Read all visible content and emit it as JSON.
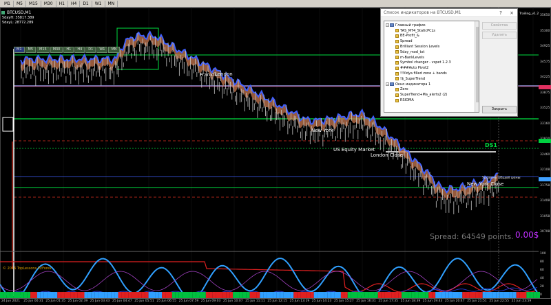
{
  "toolbar": {
    "timeframes": [
      "M1",
      "M5",
      "M15",
      "M30",
      "H1",
      "H4",
      "D1",
      "W1",
      "MN"
    ]
  },
  "chart": {
    "symbol_title": "BTCUSD,M1",
    "info_lines": [
      "5dayH: 35817.389",
      "5dayL: 28772.289"
    ],
    "mini_timeframes": [
      "M1",
      "M5",
      "M15",
      "M30",
      "H1",
      "H4",
      "D1",
      "W1",
      "MN"
    ],
    "session_labels": [
      "Frankfurt",
      "London",
      "New York",
      "US Equity Market",
      "London Close",
      "New York Close"
    ],
    "spread_text": "Spread: 64549 points.",
    "profit_text": "0.00$",
    "ds1_label": "DS1",
    "level_label": "Уровень общей цены",
    "copyright": "© 2016 TopLessons.In/Forex",
    "top_right_label": "Trailing_v1.2",
    "prices": [
      "35650",
      "35300",
      "34925",
      "34575",
      "34225",
      "33875",
      "33525",
      "33160",
      "32810",
      "32460",
      "32108",
      "31758",
      "31408",
      "31058",
      "30708"
    ],
    "time_labels": [
      "24 Jun 2021",
      "25 Jun 00:31",
      "25 Jun 01:35",
      "25 Jun 02:39",
      "25 Jun 03:43",
      "25 Jun 04:47",
      "25 Jun 05:51",
      "25 Jun 06:55",
      "25 Jun 07:59",
      "25 Jun 09:03",
      "25 Jun 10:07",
      "25 Jun 11:11",
      "25 Jun 12:15",
      "25 Jun 13:19",
      "25 Jun 14:23",
      "25 Jun 15:27",
      "25 Jun 16:31",
      "25 Jun 17:35",
      "25 Jun 18:39",
      "25 Jun 19:43",
      "25 Jun 20:47",
      "25 Jun 21:51",
      "25 Jun 22:55",
      "25 Jun 23:59"
    ],
    "indicator_scale": [
      "100",
      "80",
      "60",
      "40",
      "20",
      "0"
    ]
  },
  "dialog": {
    "title": "Список индикаторов на BTCUSD,M1",
    "help_icon": "?",
    "close_icon": "×",
    "tree": [
      {
        "level": 0,
        "type": "folder",
        "label": "Главный график"
      },
      {
        "level": 1,
        "type": "item",
        "label": "TAS_MT4_StaticPCLs"
      },
      {
        "level": 1,
        "type": "item",
        "label": "BE-Profit_&"
      },
      {
        "level": 1,
        "type": "item",
        "label": "Spread"
      },
      {
        "level": 1,
        "type": "item",
        "label": "Brilliant Session Levels"
      },
      {
        "level": 1,
        "type": "item",
        "label": "5day_mod_txt"
      },
      {
        "level": 1,
        "type": "item",
        "label": "m-BankLevels"
      },
      {
        "level": 1,
        "type": "item",
        "label": "Symbol changer - vspet 1.2.3"
      },
      {
        "level": 1,
        "type": "item",
        "label": "###Auto Pivot2"
      },
      {
        "level": 1,
        "type": "item",
        "label": "!!Vidya filled zone + bands"
      },
      {
        "level": 1,
        "type": "item",
        "label": "!$_SuperTrend"
      },
      {
        "level": 0,
        "type": "folder",
        "label": "Окно индикатора 1"
      },
      {
        "level": 1,
        "type": "item",
        "label": "Zero"
      },
      {
        "level": 1,
        "type": "item",
        "label": "SuperTrend+Ma_alerts2 (2)"
      },
      {
        "level": 1,
        "type": "item",
        "label": "RSIOMA"
      }
    ],
    "buttons": {
      "properties": "Свойства",
      "delete": "Удалить",
      "close": "Закрыть"
    }
  },
  "colors": {
    "background": "#000000",
    "candle": "#c8c8c8",
    "vidya_band": "#c87850",
    "band_edge": "#4060ff",
    "level_green": "#00e040",
    "level_red": "#e03020",
    "indicator_blue": "#30a0ff",
    "indicator_red": "#e02020"
  }
}
